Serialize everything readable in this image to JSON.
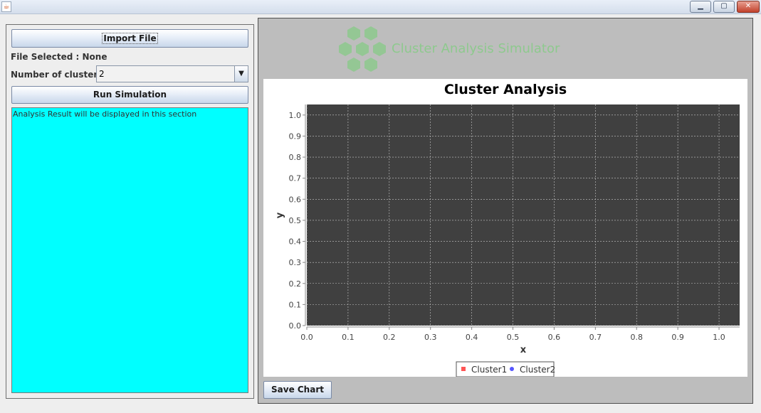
{
  "window": {
    "icon": "java-icon",
    "minimize_glyph": "▁",
    "maximize_glyph": "▢",
    "close_glyph": "✕"
  },
  "left": {
    "import_label": "Import File",
    "file_selected": "File Selected : None",
    "clusters_label": "Number of clusters:",
    "clusters_value": "2",
    "run_label": "Run Simulation",
    "result_text": "Analysis Result will be displayed in this section"
  },
  "logo": {
    "text": "Cluster Analysis Simulator",
    "color": "#8ec98e"
  },
  "save_label": "Save Chart",
  "chart_data": {
    "type": "scatter",
    "title": "Cluster Analysis",
    "xlabel": "x",
    "ylabel": "y",
    "xlim": [
      0.0,
      1.05
    ],
    "ylim": [
      0.0,
      1.05
    ],
    "xticks": [
      "0.0",
      "0.1",
      "0.2",
      "0.3",
      "0.4",
      "0.5",
      "0.6",
      "0.7",
      "0.8",
      "0.9",
      "1.0"
    ],
    "yticks": [
      "0.0",
      "0.1",
      "0.2",
      "0.3",
      "0.4",
      "0.5",
      "0.6",
      "0.7",
      "0.8",
      "0.9",
      "1.0"
    ],
    "grid": true,
    "plot_background": "#404040",
    "legend_position": "bottom",
    "series": [
      {
        "name": "Cluster1",
        "marker": "square",
        "color": "#ff5555",
        "points": []
      },
      {
        "name": "Cluster2",
        "marker": "circle",
        "color": "#5555ff",
        "points": []
      }
    ]
  }
}
